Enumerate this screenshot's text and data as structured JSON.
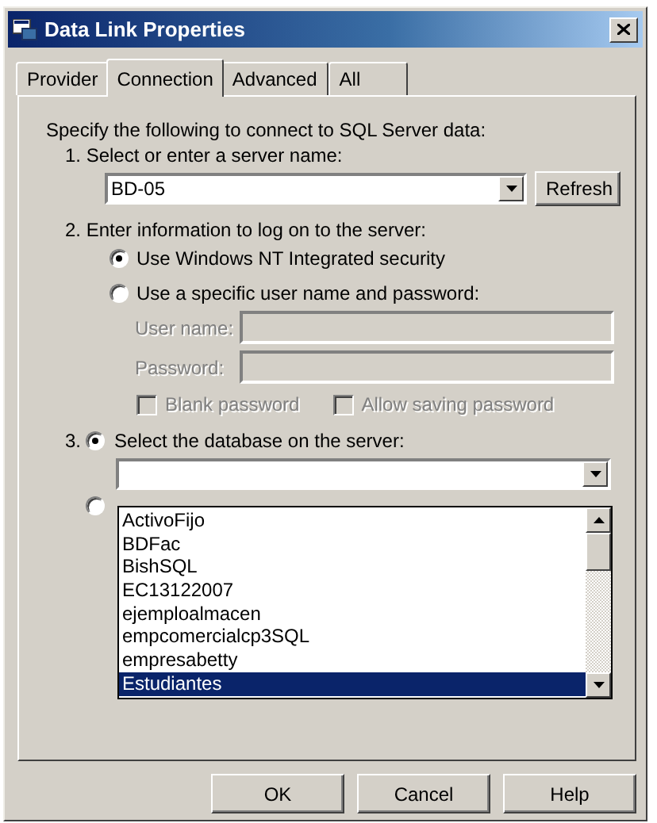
{
  "window": {
    "title": "Data Link Properties"
  },
  "tabs": [
    {
      "label": "Provider",
      "selected": false
    },
    {
      "label": "Connection",
      "selected": true
    },
    {
      "label": "Advanced",
      "selected": false
    },
    {
      "label": "All",
      "selected": false
    }
  ],
  "intro": "Specify the following to connect to SQL Server data:",
  "step1": {
    "label": "1. Select or enter a server name:",
    "server": "BD-05",
    "refresh": "Refresh"
  },
  "step2": {
    "label": "2. Enter information to log on to the server:",
    "options": [
      {
        "label": "Use Windows NT Integrated security",
        "selected": true
      },
      {
        "label": "Use a specific user name and password:",
        "selected": false
      }
    ],
    "fields": [
      {
        "label": "User name:",
        "disabled": true
      },
      {
        "label": "Password:",
        "disabled": true
      }
    ],
    "checkboxes": [
      {
        "label": "Blank password",
        "checked": false,
        "disabled": true
      },
      {
        "label": "Allow saving password",
        "checked": false,
        "disabled": true
      }
    ]
  },
  "step3": {
    "number": "3.",
    "selected": true,
    "label": "Select the database on the server:",
    "other_option_selected": false,
    "databases": [
      {
        "name": "ActivoFijo",
        "selected": false
      },
      {
        "name": "BDFac",
        "selected": false
      },
      {
        "name": "BishSQL",
        "selected": false
      },
      {
        "name": "EC13122007",
        "selected": false
      },
      {
        "name": "ejemploalmacen",
        "selected": false
      },
      {
        "name": "empcomercialcp3SQL",
        "selected": false
      },
      {
        "name": "empresabetty",
        "selected": false
      },
      {
        "name": "Estudiantes",
        "selected": true
      }
    ]
  },
  "buttons": [
    "OK",
    "Cancel",
    "Help"
  ]
}
